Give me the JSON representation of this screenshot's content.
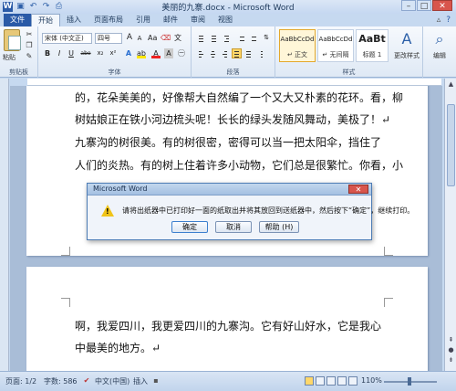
{
  "window": {
    "title": "美丽的九寨.docx - Microsoft Word",
    "qat_icons": [
      "word-icon",
      "save-icon",
      "undo-icon",
      "redo-icon",
      "print-icon"
    ],
    "controls": [
      "–",
      "□",
      "✕"
    ]
  },
  "tabs": [
    {
      "label": "文件",
      "active": false,
      "file": true
    },
    {
      "label": "开始",
      "active": true
    },
    {
      "label": "插入",
      "active": false
    },
    {
      "label": "页面布局",
      "active": false
    },
    {
      "label": "引用",
      "active": false
    },
    {
      "label": "邮件",
      "active": false
    },
    {
      "label": "审阅",
      "active": false
    },
    {
      "label": "视图",
      "active": false
    }
  ],
  "ribbon": {
    "clipboard": {
      "paste": "粘贴",
      "group_label": "剪贴板"
    },
    "font": {
      "font_name": "宋体 (中文正)",
      "font_size": "四号",
      "grow": "A",
      "shrink": "A",
      "group_label": "字体",
      "bold": "B",
      "italic": "I",
      "underline": "U",
      "strike": "abe",
      "sub": "x₂",
      "sup": "x²",
      "color_a": "A"
    },
    "paragraph": {
      "group_label": "段落"
    },
    "styles": {
      "group_label": "样式",
      "items": [
        {
          "sample": "AaBbCcDd",
          "name": "↵ 正文",
          "selected": true
        },
        {
          "sample": "AaBbCcDd",
          "name": "↵ 无间隔",
          "selected": false
        },
        {
          "sample": "AaBt",
          "name": "标题 1",
          "selected": false
        }
      ],
      "change_styles": "更改样式"
    },
    "editing": {
      "label": "编辑"
    }
  },
  "document": {
    "page1_lines": [
      "的，花朵美美的，好像帮大自然编了一个又大又朴素的花环。看，柳",
      "树姑娘正在铁小河边梳头呢！长长的绿头发随风舞动，美极了！↵",
      "    九寨沟的树很美。有的树很密，密得可以当一把太阳伞，挡住了",
      "人们的炎热。有的树上住着许多小动物，它们总是很繁忙。你看，小"
    ],
    "page2_lines": [
      "    啊，我爱四川，我更爱四川的九寨沟。它有好山好水，它是我心",
      "中最美的地方。↵"
    ]
  },
  "dialog": {
    "title": "Microsoft Word",
    "message": "请将出纸器中已打印好一面的纸取出并将其放回到送纸器中，然后按下“确定”，继续打印。",
    "buttons": {
      "ok": "确定",
      "cancel": "取消",
      "help": "帮助 (H)"
    }
  },
  "statusbar": {
    "page": "页面: 1/2",
    "words": "字数: 586",
    "language": "中文(中国)",
    "insert": "插入",
    "zoom": "110%"
  }
}
